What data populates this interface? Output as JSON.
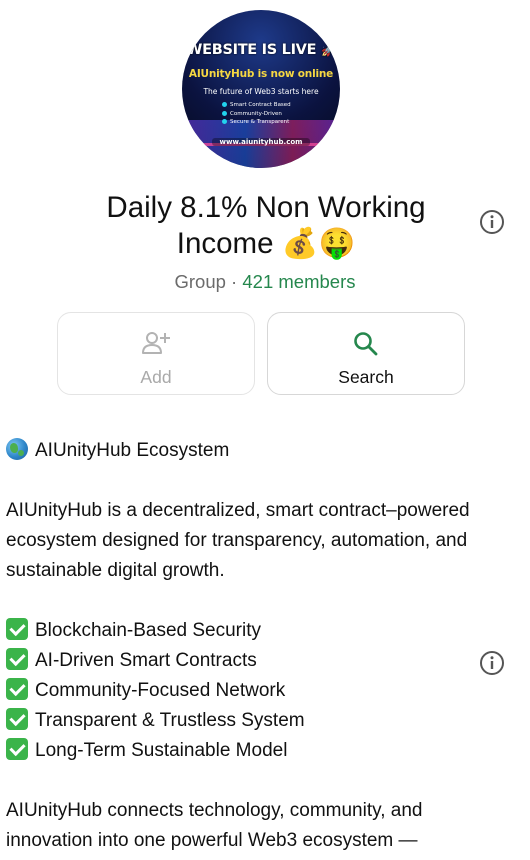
{
  "group": {
    "avatar": {
      "headline": "WEBSITE IS LIVE",
      "subline": "AIUnityHub is now online",
      "tagline": "The future of Web3 starts here",
      "bullets": [
        "Smart Contract Based",
        "Community-Driven",
        "Secure & Transparent"
      ],
      "url": "www.aiunityhub.com",
      "rocket": "🚀"
    },
    "name": "Daily 8.1% Non Working Income 💰🤑",
    "type_label": "Group",
    "separator": " · ",
    "members_label": "421 members"
  },
  "actions": {
    "add_label": "Add",
    "search_label": "Search"
  },
  "description": {
    "heading": "AIUnityHub Ecosystem",
    "intro": "AIUnityHub is a decentralized, smart contract–powered ecosystem designed for transparency, automation, and sustainable digital growth.",
    "features": [
      "Blockchain-Based Security",
      "AI-Driven Smart Contracts",
      "Community-Focused Network",
      "Transparent & Trustless System",
      "Long-Term Sustainable Model"
    ],
    "closing": "AIUnityHub connects technology, community, and innovation into one powerful Web3 ecosystem —"
  },
  "colors": {
    "accent_green": "#25874d",
    "muted_text": "#6b6b6b",
    "check_green": "#3bb44a"
  },
  "icons": {
    "info": "info-icon",
    "add_person": "add-person-icon",
    "search": "search-icon",
    "globe": "globe-emoji",
    "check": "check-mark-emoji"
  }
}
